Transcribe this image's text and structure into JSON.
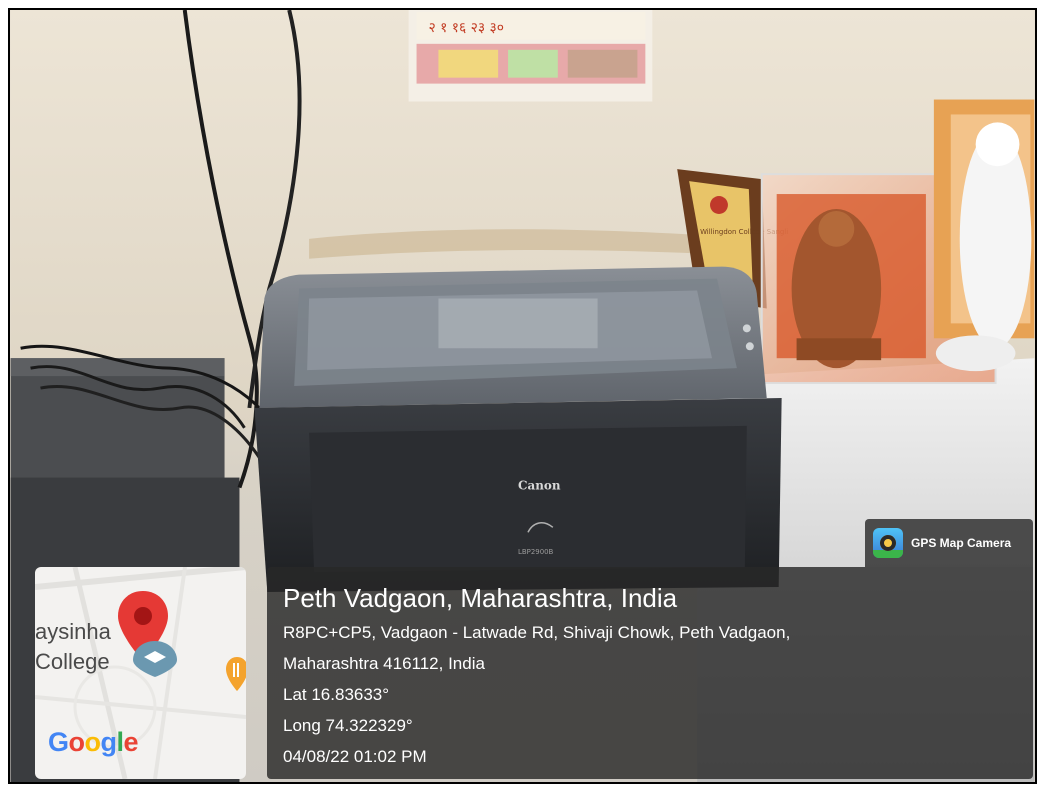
{
  "overlay": {
    "app_name": "GPS Map Camera",
    "place_title": "Peth Vadgaon, Maharashtra, India",
    "address_line_1": "R8PC+CP5, Vadgaon - Latwade Rd, Shivaji Chowk, Peth Vadgaon,",
    "address_line_2": "Maharashtra 416112, India",
    "latitude": "Lat 16.83633°",
    "longitude": "Long 74.322329°",
    "datetime": "04/08/22 01:02 PM"
  },
  "map": {
    "label_line_1": "aysinha",
    "label_line_2": "College",
    "logo": {
      "letters": [
        "G",
        "o",
        "o",
        "g",
        "l",
        "e"
      ],
      "colors": [
        "#4285F4",
        "#EA4335",
        "#FBBC05",
        "#4285F4",
        "#34A853",
        "#EA4335"
      ]
    }
  },
  "photo": {
    "calendar_numbers": "२ १ १६ २३ ३०",
    "printer_brand": "Canon",
    "printer_model": "LBP2900B",
    "trophy_text": "Willingdon College Sangli"
  },
  "icons": {
    "map_pin": "map-pin-icon",
    "restaurant": "restaurant-icon",
    "gps_app": "gps-map-camera-icon"
  }
}
